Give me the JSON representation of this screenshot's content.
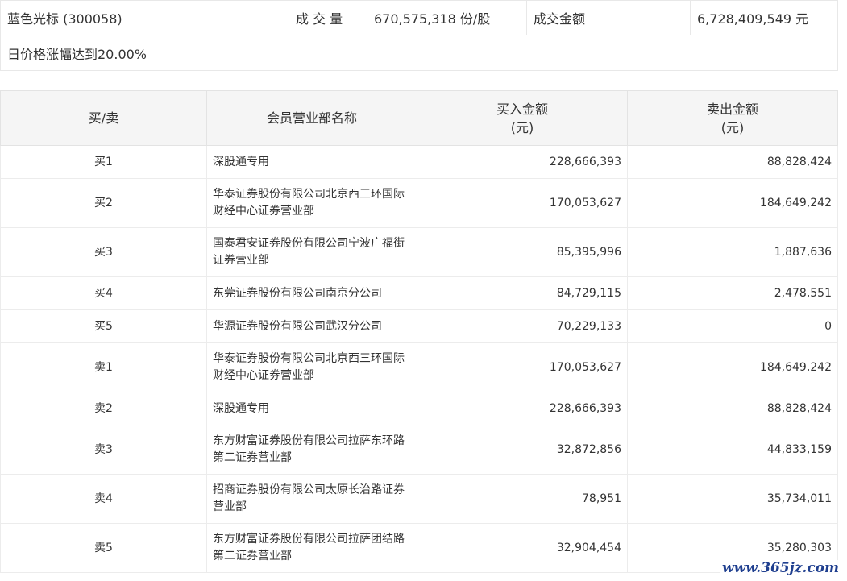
{
  "summary": {
    "stock_name": "蓝色光标 (300058)",
    "volume_label": "成 交 量",
    "volume_value": "670,575,318 份/股",
    "amount_label": "成交金额",
    "amount_value": "6,728,409,549 元",
    "reason": "日价格涨幅达到20.00%"
  },
  "table": {
    "headers": {
      "side": "买/卖",
      "name": "会员营业部名称",
      "buy_line1": "买入金额",
      "buy_line2": "(元)",
      "sell_line1": "卖出金额",
      "sell_line2": "(元)"
    },
    "rows": [
      {
        "side": "买1",
        "name_line1": "深股通专用",
        "name_line2": "",
        "buy": "228,666,393",
        "sell": "88,828,424"
      },
      {
        "side": "买2",
        "name_line1": "华泰证券股份有限公司北京西三环国际",
        "name_line2": "财经中心证券营业部",
        "buy": "170,053,627",
        "sell": "184,649,242"
      },
      {
        "side": "买3",
        "name_line1": "国泰君安证券股份有限公司宁波广福街",
        "name_line2": "证券营业部",
        "buy": "85,395,996",
        "sell": "1,887,636"
      },
      {
        "side": "买4",
        "name_line1": "东莞证券股份有限公司南京分公司",
        "name_line2": "",
        "buy": "84,729,115",
        "sell": "2,478,551"
      },
      {
        "side": "买5",
        "name_line1": "华源证券股份有限公司武汉分公司",
        "name_line2": "",
        "buy": "70,229,133",
        "sell": "0"
      },
      {
        "side": "卖1",
        "name_line1": "华泰证券股份有限公司北京西三环国际",
        "name_line2": "财经中心证券营业部",
        "buy": "170,053,627",
        "sell": "184,649,242"
      },
      {
        "side": "卖2",
        "name_line1": "深股通专用",
        "name_line2": "",
        "buy": "228,666,393",
        "sell": "88,828,424"
      },
      {
        "side": "卖3",
        "name_line1": "东方财富证券股份有限公司拉萨东环路",
        "name_line2": "第二证券营业部",
        "buy": "32,872,856",
        "sell": "44,833,159"
      },
      {
        "side": "卖4",
        "name_line1": "招商证券股份有限公司太原长治路证券",
        "name_line2": "营业部",
        "buy": "78,951",
        "sell": "35,734,011"
      },
      {
        "side": "卖5",
        "name_line1": "东方财富证券股份有限公司拉萨团结路",
        "name_line2": "第二证券营业部",
        "buy": "32,904,454",
        "sell": "35,280,303"
      }
    ]
  },
  "watermark": "www.365jz.com",
  "colors": {
    "header_bg": "#f5f5f5",
    "border": "#e8e8e8",
    "text": "#333333",
    "watermark": "#1f3f8f"
  }
}
